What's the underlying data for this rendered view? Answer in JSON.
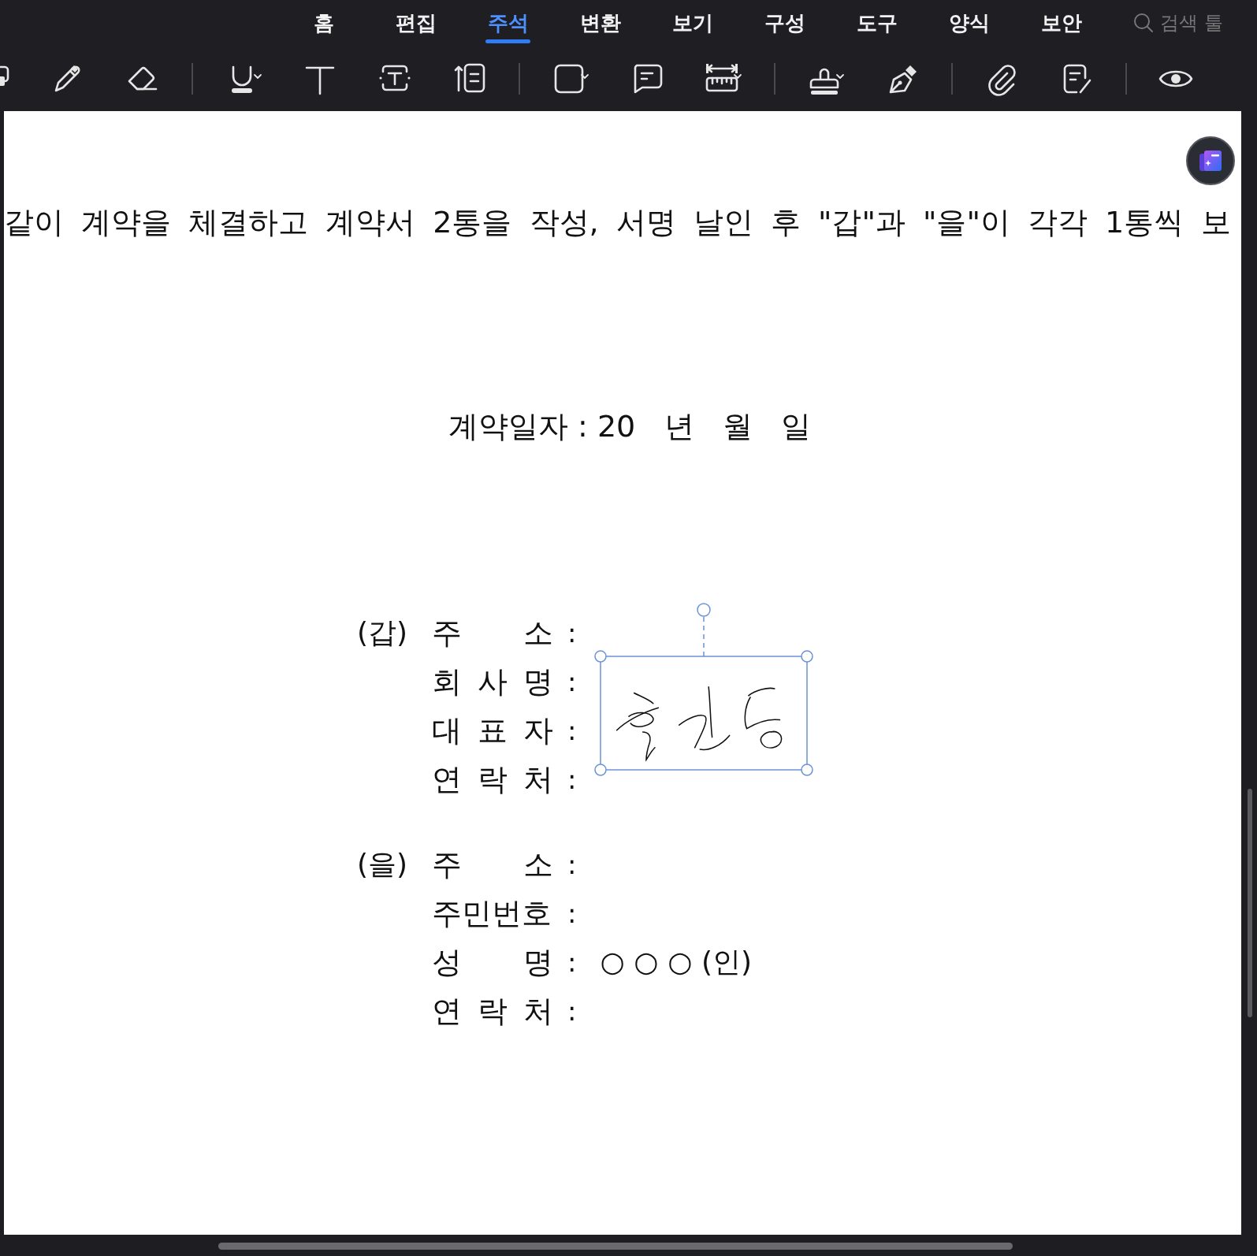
{
  "toolbar": {
    "tabs": [
      {
        "label": "홈",
        "selected": false
      },
      {
        "label": "편집",
        "selected": false
      },
      {
        "label": "주석",
        "selected": true
      },
      {
        "label": "변환",
        "selected": false
      },
      {
        "label": "보기",
        "selected": false
      },
      {
        "label": "구성",
        "selected": false
      },
      {
        "label": "도구",
        "selected": false
      },
      {
        "label": "양식",
        "selected": false
      },
      {
        "label": "보안",
        "selected": false
      }
    ],
    "search": {
      "placeholder": "검색 툴"
    }
  },
  "document": {
    "body_line": "같이 계약을 체결하고 계약서 2통을 작성, 서명 날인 후 \"갑\"과 \"을\"이 각각 1통씩 보",
    "date_line": "계약일자 : 20   년   월   일",
    "parties": [
      {
        "tag": "(갑)",
        "fields": [
          {
            "label": "주 소",
            "colon": ":"
          },
          {
            "label": "회 사 명",
            "colon": ":"
          },
          {
            "label": "대 표 자",
            "colon": ":"
          },
          {
            "label": "연 락 처",
            "colon": ":"
          }
        ]
      },
      {
        "tag": "(을)",
        "fields": [
          {
            "label": "주 소",
            "colon": ":"
          },
          {
            "label": "주민번호",
            "colon": ":"
          },
          {
            "label": "성 명",
            "colon": ":",
            "value": "○ ○ ○ (인)"
          },
          {
            "label": "연 락 처",
            "colon": ":"
          }
        ]
      }
    ],
    "signature": {
      "selected": true
    }
  }
}
